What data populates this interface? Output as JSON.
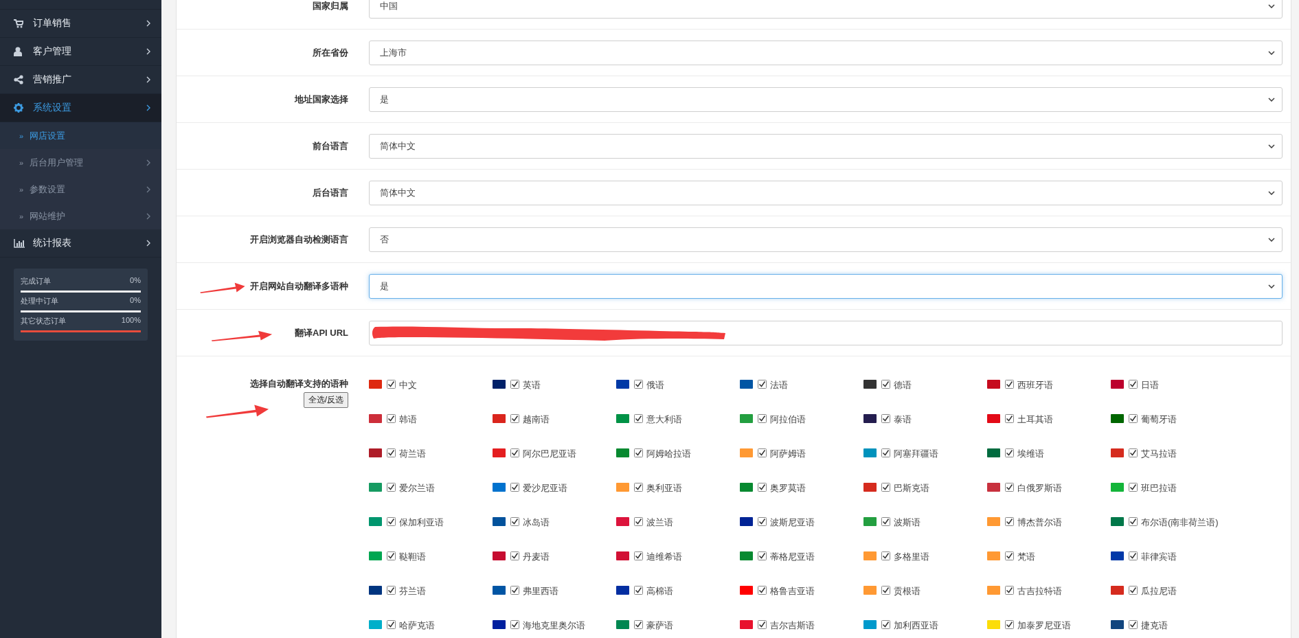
{
  "sidebar": {
    "items": [
      {
        "label": "订单销售",
        "selected": false
      },
      {
        "label": "客户管理",
        "selected": false
      },
      {
        "label": "营销推广",
        "selected": false
      },
      {
        "label": "系统设置",
        "selected": true,
        "children": [
          {
            "marker": "»",
            "label": "网店设置",
            "selected": true,
            "has_arrow": false
          },
          {
            "marker": "»",
            "label": "后台用户管理",
            "selected": false,
            "has_arrow": true
          },
          {
            "marker": "»",
            "label": "参数设置",
            "selected": false,
            "has_arrow": true
          },
          {
            "marker": "»",
            "label": "网站维护",
            "selected": false,
            "has_arrow": true
          }
        ]
      },
      {
        "label": "统计报表",
        "selected": false
      }
    ],
    "stats": [
      {
        "label": "完成订单",
        "reading": "0%",
        "level": 0
      },
      {
        "label": "处理中订单",
        "reading": "0%",
        "level": 0
      },
      {
        "label": "其它状态订单",
        "reading": "100%",
        "level": 1
      }
    ]
  },
  "form": {
    "fields": [
      {
        "kind": "select",
        "label": "国家归属",
        "value": "中国",
        "focused": false
      },
      {
        "kind": "select",
        "label": "所在省份",
        "value": "上海市",
        "focused": false
      },
      {
        "kind": "select",
        "label": "地址国家选择",
        "value": "是",
        "focused": false
      },
      {
        "kind": "select",
        "label": "前台语言",
        "value": "简体中文",
        "focused": false
      },
      {
        "kind": "select",
        "label": "后台语言",
        "value": "简体中文",
        "focused": false
      },
      {
        "kind": "select",
        "label": "开启浏览器自动检测语言",
        "value": "否",
        "focused": false
      },
      {
        "kind": "select",
        "label": "开启网站自动翻译多语种",
        "value": "是",
        "focused": true
      },
      {
        "kind": "text",
        "label": "翻译API URL",
        "redacted": true
      }
    ],
    "languages_label": "选择自动翻译支持的语种",
    "toggle_button": "全选/反选",
    "languages": [
      {
        "label": "中文",
        "checked": true,
        "color": "#de2910"
      },
      {
        "label": "英语",
        "checked": true,
        "color": "#012169"
      },
      {
        "label": "俄语",
        "checked": true,
        "color": "#0039a6"
      },
      {
        "label": "法语",
        "checked": true,
        "color": "#0055a4"
      },
      {
        "label": "德语",
        "checked": true,
        "color": "#333333"
      },
      {
        "label": "西班牙语",
        "checked": true,
        "color": "#c60b1e"
      },
      {
        "label": "日语",
        "checked": true,
        "color": "#bc002d"
      },
      {
        "label": "韩语",
        "checked": true,
        "color": "#cd2e3a"
      },
      {
        "label": "越南语",
        "checked": true,
        "color": "#da251d"
      },
      {
        "label": "意大利语",
        "checked": true,
        "color": "#009246"
      },
      {
        "label": "阿拉伯语",
        "checked": true,
        "color": "#239f40"
      },
      {
        "label": "泰语",
        "checked": true,
        "color": "#241d4f"
      },
      {
        "label": "土耳其语",
        "checked": true,
        "color": "#e30a17"
      },
      {
        "label": "葡萄牙语",
        "checked": true,
        "color": "#006600"
      },
      {
        "label": "荷兰语",
        "checked": true,
        "color": "#ae1c28"
      },
      {
        "label": "阿尔巴尼亚语",
        "checked": true,
        "color": "#e41e20"
      },
      {
        "label": "阿姆哈拉语",
        "checked": true,
        "color": "#078930"
      },
      {
        "label": "阿萨姆语",
        "checked": true,
        "color": "#ff9933"
      },
      {
        "label": "阿塞拜疆语",
        "checked": true,
        "color": "#0092bc"
      },
      {
        "label": "埃维语",
        "checked": true,
        "color": "#006b3f"
      },
      {
        "label": "艾马拉语",
        "checked": true,
        "color": "#d52b1e"
      },
      {
        "label": "爱尔兰语",
        "checked": true,
        "color": "#169b62"
      },
      {
        "label": "爱沙尼亚语",
        "checked": true,
        "color": "#0072ce"
      },
      {
        "label": "奥利亚语",
        "checked": true,
        "color": "#ff9933"
      },
      {
        "label": "奥罗莫语",
        "checked": true,
        "color": "#078930"
      },
      {
        "label": "巴斯克语",
        "checked": true,
        "color": "#d52b1e"
      },
      {
        "label": "白俄罗斯语",
        "checked": true,
        "color": "#c8313e"
      },
      {
        "label": "班巴拉语",
        "checked": true,
        "color": "#14b53a"
      },
      {
        "label": "保加利亚语",
        "checked": true,
        "color": "#00966e"
      },
      {
        "label": "冰岛语",
        "checked": true,
        "color": "#02529c"
      },
      {
        "label": "波兰语",
        "checked": true,
        "color": "#dc143c"
      },
      {
        "label": "波斯尼亚语",
        "checked": true,
        "color": "#002395"
      },
      {
        "label": "波斯语",
        "checked": true,
        "color": "#239f40"
      },
      {
        "label": "博杰普尔语",
        "checked": true,
        "color": "#ff9933"
      },
      {
        "label": "布尔语(南非荷兰语)",
        "checked": true,
        "color": "#007749"
      },
      {
        "label": "鞑靼语",
        "checked": true,
        "color": "#00a651"
      },
      {
        "label": "丹麦语",
        "checked": true,
        "color": "#c60c30"
      },
      {
        "label": "迪维希语",
        "checked": true,
        "color": "#d21034"
      },
      {
        "label": "蒂格尼亚语",
        "checked": true,
        "color": "#078930"
      },
      {
        "label": "多格里语",
        "checked": true,
        "color": "#ff9933"
      },
      {
        "label": "梵语",
        "checked": true,
        "color": "#ff9933"
      },
      {
        "label": "菲律宾语",
        "checked": true,
        "color": "#0038a8"
      },
      {
        "label": "芬兰语",
        "checked": true,
        "color": "#003580"
      },
      {
        "label": "弗里西语",
        "checked": true,
        "color": "#0055a4"
      },
      {
        "label": "高棉语",
        "checked": true,
        "color": "#032ea1"
      },
      {
        "label": "格鲁吉亚语",
        "checked": true,
        "color": "#ff0000"
      },
      {
        "label": "贡根语",
        "checked": true,
        "color": "#ff9933"
      },
      {
        "label": "古吉拉特语",
        "checked": true,
        "color": "#ff9933"
      },
      {
        "label": "瓜拉尼语",
        "checked": true,
        "color": "#d52b1e"
      },
      {
        "label": "哈萨克语",
        "checked": true,
        "color": "#00afca"
      },
      {
        "label": "海地克里奥尔语",
        "checked": true,
        "color": "#00209f"
      },
      {
        "label": "豪萨语",
        "checked": true,
        "color": "#008751"
      },
      {
        "label": "吉尔吉斯语",
        "checked": true,
        "color": "#e8112d"
      },
      {
        "label": "加利西亚语",
        "checked": true,
        "color": "#0099cc"
      },
      {
        "label": "加泰罗尼亚语",
        "checked": true,
        "color": "#fcdd09"
      },
      {
        "label": "捷克语",
        "checked": true,
        "color": "#11457e"
      }
    ]
  }
}
